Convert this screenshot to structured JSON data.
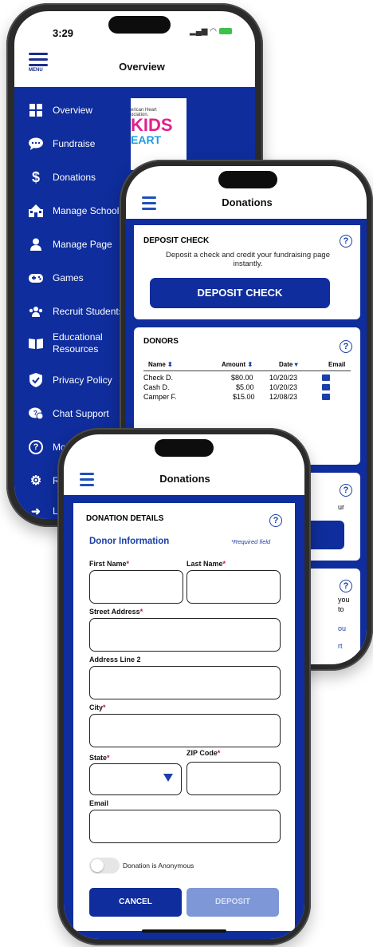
{
  "phone1": {
    "status_time": "3:29",
    "menu_label": "MENU",
    "title": "Overview",
    "nav": [
      {
        "label": "Overview",
        "icon": "grid-icon"
      },
      {
        "label": "Fundraise",
        "icon": "chat-bubble-icon"
      },
      {
        "label": "Donations",
        "icon": "dollar-icon"
      },
      {
        "label": "Manage School",
        "icon": "school-icon"
      },
      {
        "label": "Manage Page",
        "icon": "person-icon"
      },
      {
        "label": "Games",
        "icon": "gamepad-icon"
      },
      {
        "label": "Recruit Students",
        "icon": "group-icon"
      },
      {
        "label": "Educational\nResources",
        "icon": "book-icon"
      },
      {
        "label": "Privacy Policy",
        "icon": "shield-icon"
      },
      {
        "label": "Chat Support",
        "icon": "support-chat-icon"
      },
      {
        "label": "Mob",
        "icon": "question-icon"
      },
      {
        "label": "Ra",
        "icon": "gear-icon"
      },
      {
        "label": "Lo",
        "icon": "logout-icon"
      }
    ],
    "promo": {
      "org_line1": "erican Heart",
      "org_line2": "ociation.",
      "word1": "KIDS",
      "word2": "EART"
    }
  },
  "phone2": {
    "title": "Donations",
    "deposit_card": {
      "heading": "DEPOSIT CHECK",
      "text": "Deposit a check and credit your fundraising page instantly.",
      "button": "DEPOSIT CHECK"
    },
    "donors": {
      "heading": "DONORS",
      "columns": [
        "Name",
        "Amount",
        "Date",
        "Email"
      ],
      "rows": [
        {
          "name": "Check D.",
          "amount": "$80.00",
          "date": "10/20/23"
        },
        {
          "name": "Cash D.",
          "amount": "$5.00",
          "date": "10/20/23"
        },
        {
          "name": "Camper F.",
          "amount": "$15.00",
          "date": "12/08/23"
        }
      ]
    },
    "peek": {
      "text1": "ur",
      "text2": "you",
      "text3": "to",
      "text4": "ou",
      "text5": "rt"
    }
  },
  "phone3": {
    "title": "Donations",
    "section_title": "DONATION DETAILS",
    "subhead": "Donor Information",
    "required_note": "*Required field",
    "fields": {
      "first_name": "First Name",
      "last_name": "Last Name",
      "street": "Street Address",
      "address2": "Address Line 2",
      "city": "City",
      "state": "State",
      "zip": "ZIP Code",
      "email": "Email"
    },
    "anonymous_label": "Donation is Anonymous",
    "cancel": "CANCEL",
    "deposit": "DEPOSIT"
  },
  "colors": {
    "brand_blue": "#0f2d9c",
    "accent_blue": "#1b3fa8",
    "required_red": "#c8102e"
  }
}
